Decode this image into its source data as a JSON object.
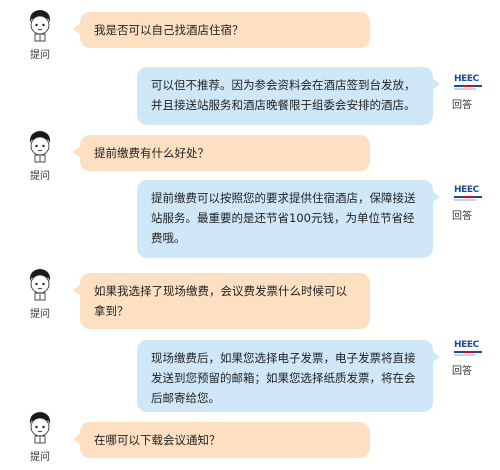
{
  "ask_label": "提问",
  "answer_label": "回答",
  "logo_text": "HEEC",
  "colors": {
    "question_bubble": "#fde0c2",
    "answer_bubble": "#cfe7f7",
    "logo_blue": "#1a4e8f",
    "logo_red": "#c8102e"
  },
  "messages": [
    {
      "role": "question",
      "text": "我是否可以自己找酒店住宿？"
    },
    {
      "role": "answer",
      "text": "可以但不推荐。因为参会资料会在酒店签到台发放，并且接送站服务和酒店晚餐限于组委会安排的酒店。"
    },
    {
      "role": "question",
      "text": "提前缴费有什么好处？"
    },
    {
      "role": "answer",
      "text": "提前缴费可以按照您的要求提供住宿酒店，保障接送站服务。最重要的是还节省100元钱，为单位节省经费哦。"
    },
    {
      "role": "question",
      "text": "如果我选择了现场缴费，会议费发票什么时候可以拿到？"
    },
    {
      "role": "answer",
      "text": "现场缴费后，如果您选择电子发票，电子发票将直接发送到您预留的邮箱；如果您选择纸质发票，将在会后邮寄给您。"
    },
    {
      "role": "question",
      "text": "在哪可以下载会议通知？"
    }
  ]
}
